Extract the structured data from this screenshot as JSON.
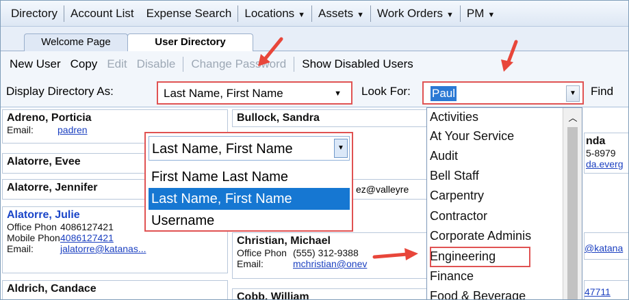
{
  "menu": {
    "items": [
      {
        "label": "Directory",
        "dropdown": false
      },
      {
        "label": "Account List",
        "dropdown": false
      },
      {
        "label": "Expense Search",
        "dropdown": false
      },
      {
        "label": "Locations",
        "dropdown": true
      },
      {
        "label": "Assets",
        "dropdown": true
      },
      {
        "label": "Work Orders",
        "dropdown": true
      },
      {
        "label": "PM",
        "dropdown": true
      }
    ]
  },
  "tabs": {
    "welcome": "Welcome Page",
    "user_directory": "User Directory"
  },
  "toolbar": {
    "new_user": "New User",
    "copy": "Copy",
    "edit": "Edit",
    "disable": "Disable",
    "change_password": "Change Password",
    "show_disabled": "Show Disabled Users"
  },
  "filter": {
    "display_label": "Display Directory As:",
    "display_value": "Last Name, First Name",
    "lookfor_label": "Look For:",
    "lookfor_value": "Paul",
    "find_label": "Find"
  },
  "display_dropdown": {
    "current": "Last Name, First Name",
    "options": [
      "First Name Last Name",
      "Last Name, First Name",
      "Username"
    ],
    "selected_index": 1
  },
  "lookfor_dropdown": {
    "items": [
      "Activities",
      "At Your Service",
      "Audit",
      "Bell Staff",
      "Carpentry",
      "Contractor",
      "Corporate Adminis",
      "Engineering",
      "Finance",
      "Food & Beverage"
    ],
    "highlighted": "Engineering"
  },
  "cards": {
    "adreno": {
      "name": "Adreno, Porticia",
      "email_label": "Email:",
      "email": "padren"
    },
    "alatorre_evee": {
      "name": "Alatorre, Evee"
    },
    "alatorre_jennifer": {
      "name": "Alatorre, Jennifer"
    },
    "alatorre_julie": {
      "name": "Alatorre, Julie",
      "office_label": "Office Phon",
      "office": "4086127421",
      "mobile_label": "Mobile Phon",
      "mobile": "4086127421",
      "email_label": "Email:",
      "email": "jalatorre@katanas..."
    },
    "aldrich": {
      "name": "Aldrich, Candace"
    },
    "bullock": {
      "name": "Bullock, Sandra"
    },
    "partial_email": "ez@valleyre",
    "christian": {
      "name": "Christian, Michael",
      "office_label": "Office Phon",
      "office": "(555) 312-9388",
      "email_label": "Email:",
      "email": "mchristian@onev"
    },
    "cobb": {
      "name": "Cobb, William"
    },
    "right_fragments": {
      "name": "nda",
      "phone": "5-8979",
      "email": "da.everg",
      "email2": "@katana",
      "phone2": "47711"
    }
  }
}
